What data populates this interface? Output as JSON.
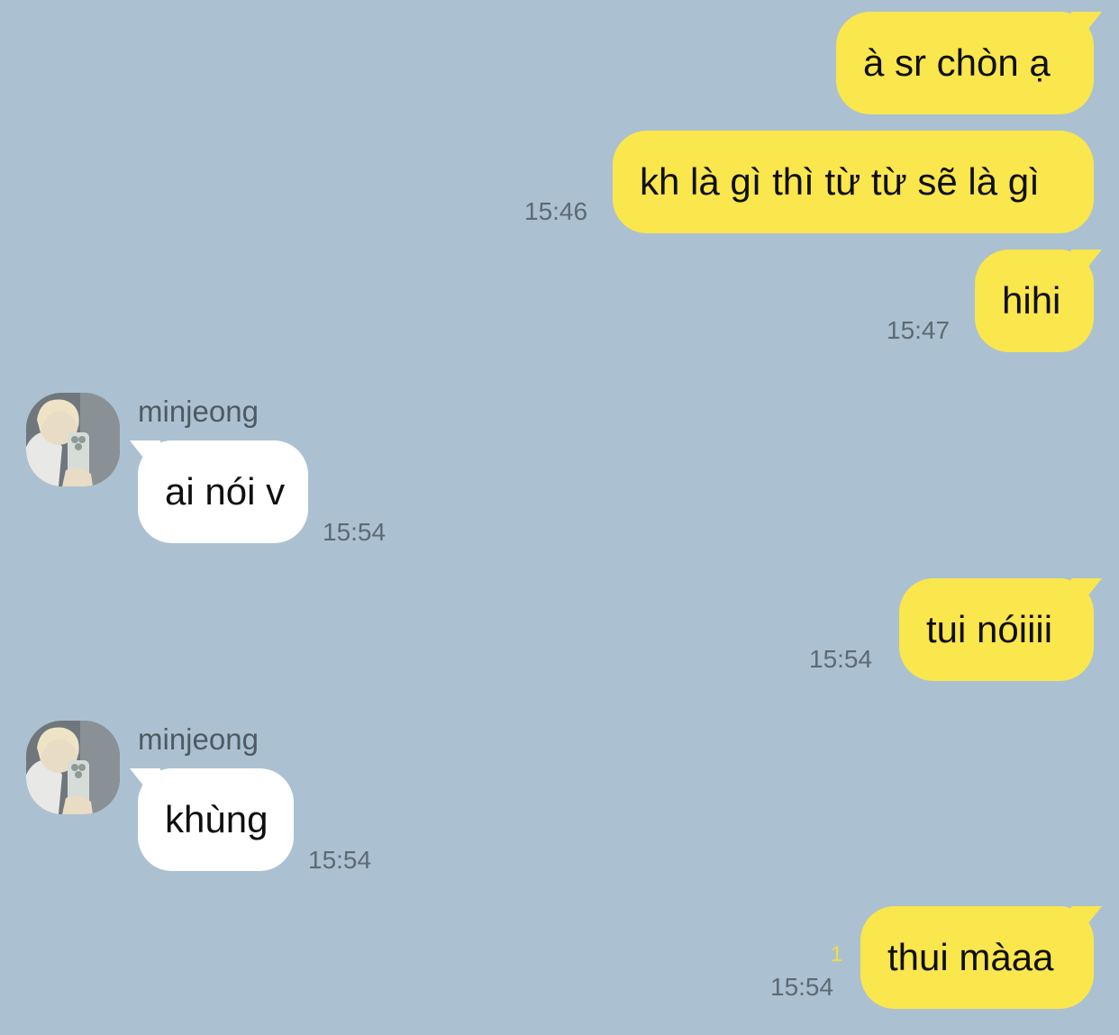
{
  "messages": [
    {
      "from": "me",
      "text": "à sr chòn ạ",
      "time": ""
    },
    {
      "from": "me",
      "text": "kh là gì thì từ từ sẽ là gì",
      "time": "15:46"
    },
    {
      "from": "me",
      "text": "hihi",
      "time": "15:47"
    },
    {
      "from": "minjeong",
      "sender_name": "minjeong",
      "text": "ai nói v",
      "time": "15:54"
    },
    {
      "from": "me",
      "text": "tui nóiiii",
      "time": "15:54"
    },
    {
      "from": "minjeong",
      "sender_name": "minjeong",
      "text": "khùng",
      "time": "15:54"
    },
    {
      "from": "me",
      "text": "thui màaa",
      "time": "15:54",
      "unread_count": "1"
    }
  ],
  "colors": {
    "background": "#abc1d1",
    "my_bubble": "#fae64d",
    "their_bubble": "#ffffff",
    "timestamp": "#5d6a74",
    "unread": "#f6dd3a"
  },
  "icons": {
    "avatar": "profile-photo"
  }
}
